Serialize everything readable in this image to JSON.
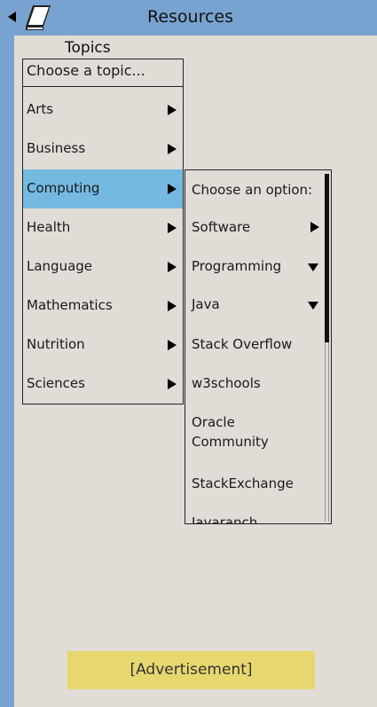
{
  "header": {
    "title": "Resources",
    "back_icon": "back-arrow-icon",
    "book_icon": "book-icon",
    "color": "#78a2cf"
  },
  "topics": {
    "label": "Topics",
    "placeholder": "Choose a topic...",
    "items": [
      {
        "label": "Arts"
      },
      {
        "label": "Business"
      },
      {
        "label": "Computing",
        "selected": true
      },
      {
        "label": "Health"
      },
      {
        "label": "Language"
      },
      {
        "label": "Mathematics"
      },
      {
        "label": "Nutrition"
      },
      {
        "label": "Sciences"
      }
    ],
    "selected_color": "#74b9e0"
  },
  "options": {
    "placeholder": "Choose an option:",
    "items": [
      {
        "label": "Software",
        "icon": "right"
      },
      {
        "label": "Programming",
        "icon": "down"
      },
      {
        "label": "Java",
        "icon": "down"
      },
      {
        "label": "Stack Overflow"
      },
      {
        "label": "w3schools"
      },
      {
        "label": "Oracle Community"
      },
      {
        "label": "StackExchange"
      },
      {
        "label": "Javaranch"
      }
    ]
  },
  "ad": {
    "label": "[Advertisement]",
    "color": "#e6d86e"
  }
}
